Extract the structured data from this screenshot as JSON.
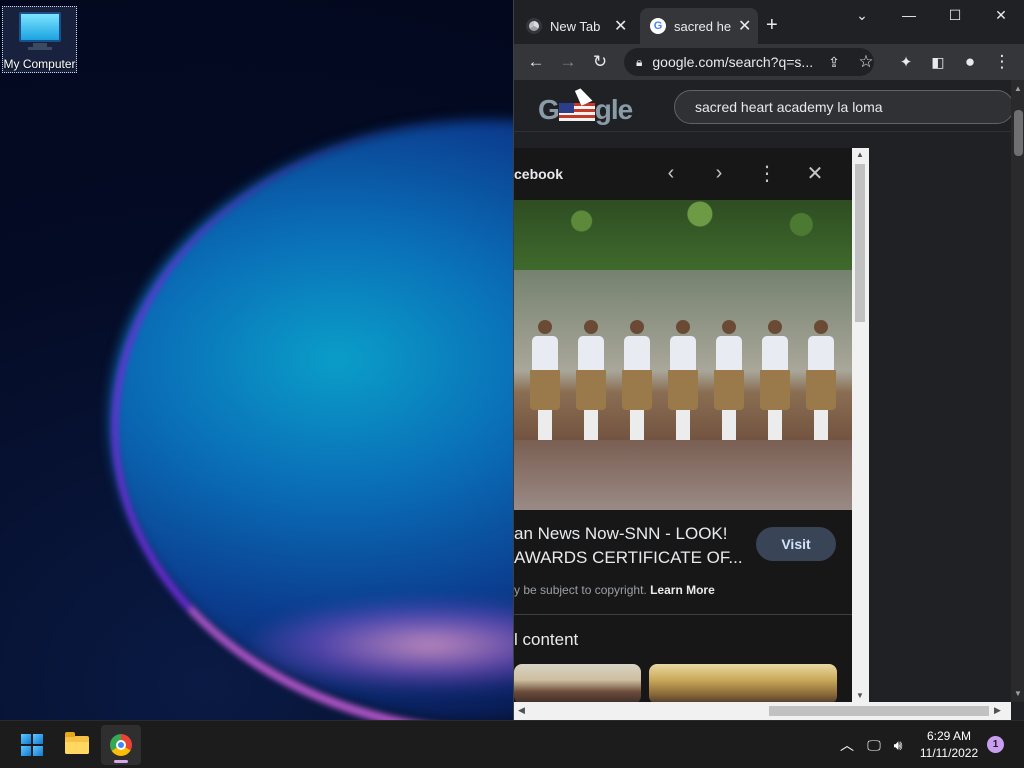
{
  "desktop": {
    "icon_label": "My Computer",
    "icon_name": "monitor-icon"
  },
  "chrome": {
    "tabs": [
      {
        "title": "New Tab",
        "icon": "chrome-icon",
        "active": false
      },
      {
        "title": "sacred he",
        "icon": "google-g-icon",
        "active": true
      }
    ],
    "toolbar": {
      "url": "google.com/search?q=s..."
    },
    "google": {
      "logo_text": "Google",
      "search_query": "sacred heart academy la loma"
    },
    "preview_panel": {
      "source": "cebook",
      "caption_line1": "an News Now-SNN - LOOK!",
      "caption_line2": "AWARDS CERTIFICATE OF...",
      "visit_label": "Visit",
      "copyright_text": "y be subject to copyright.",
      "learn_more": "Learn More",
      "related_heading": "l content"
    }
  },
  "taskbar": {
    "apps": [
      {
        "name": "start",
        "icon": "windows-start-icon"
      },
      {
        "name": "file-explorer",
        "icon": "folder-icon"
      },
      {
        "name": "chrome",
        "icon": "chrome-icon",
        "active": true
      }
    ],
    "clock_time": "6:29 AM",
    "clock_date": "11/11/2022",
    "notification_count": "1"
  },
  "colors": {
    "chrome_bg": "#202124",
    "chrome_toolbar": "#35363a",
    "visit_button": "#394457",
    "taskbar_bg": "#1c1c1c",
    "notification_badge": "#c99ef0"
  }
}
